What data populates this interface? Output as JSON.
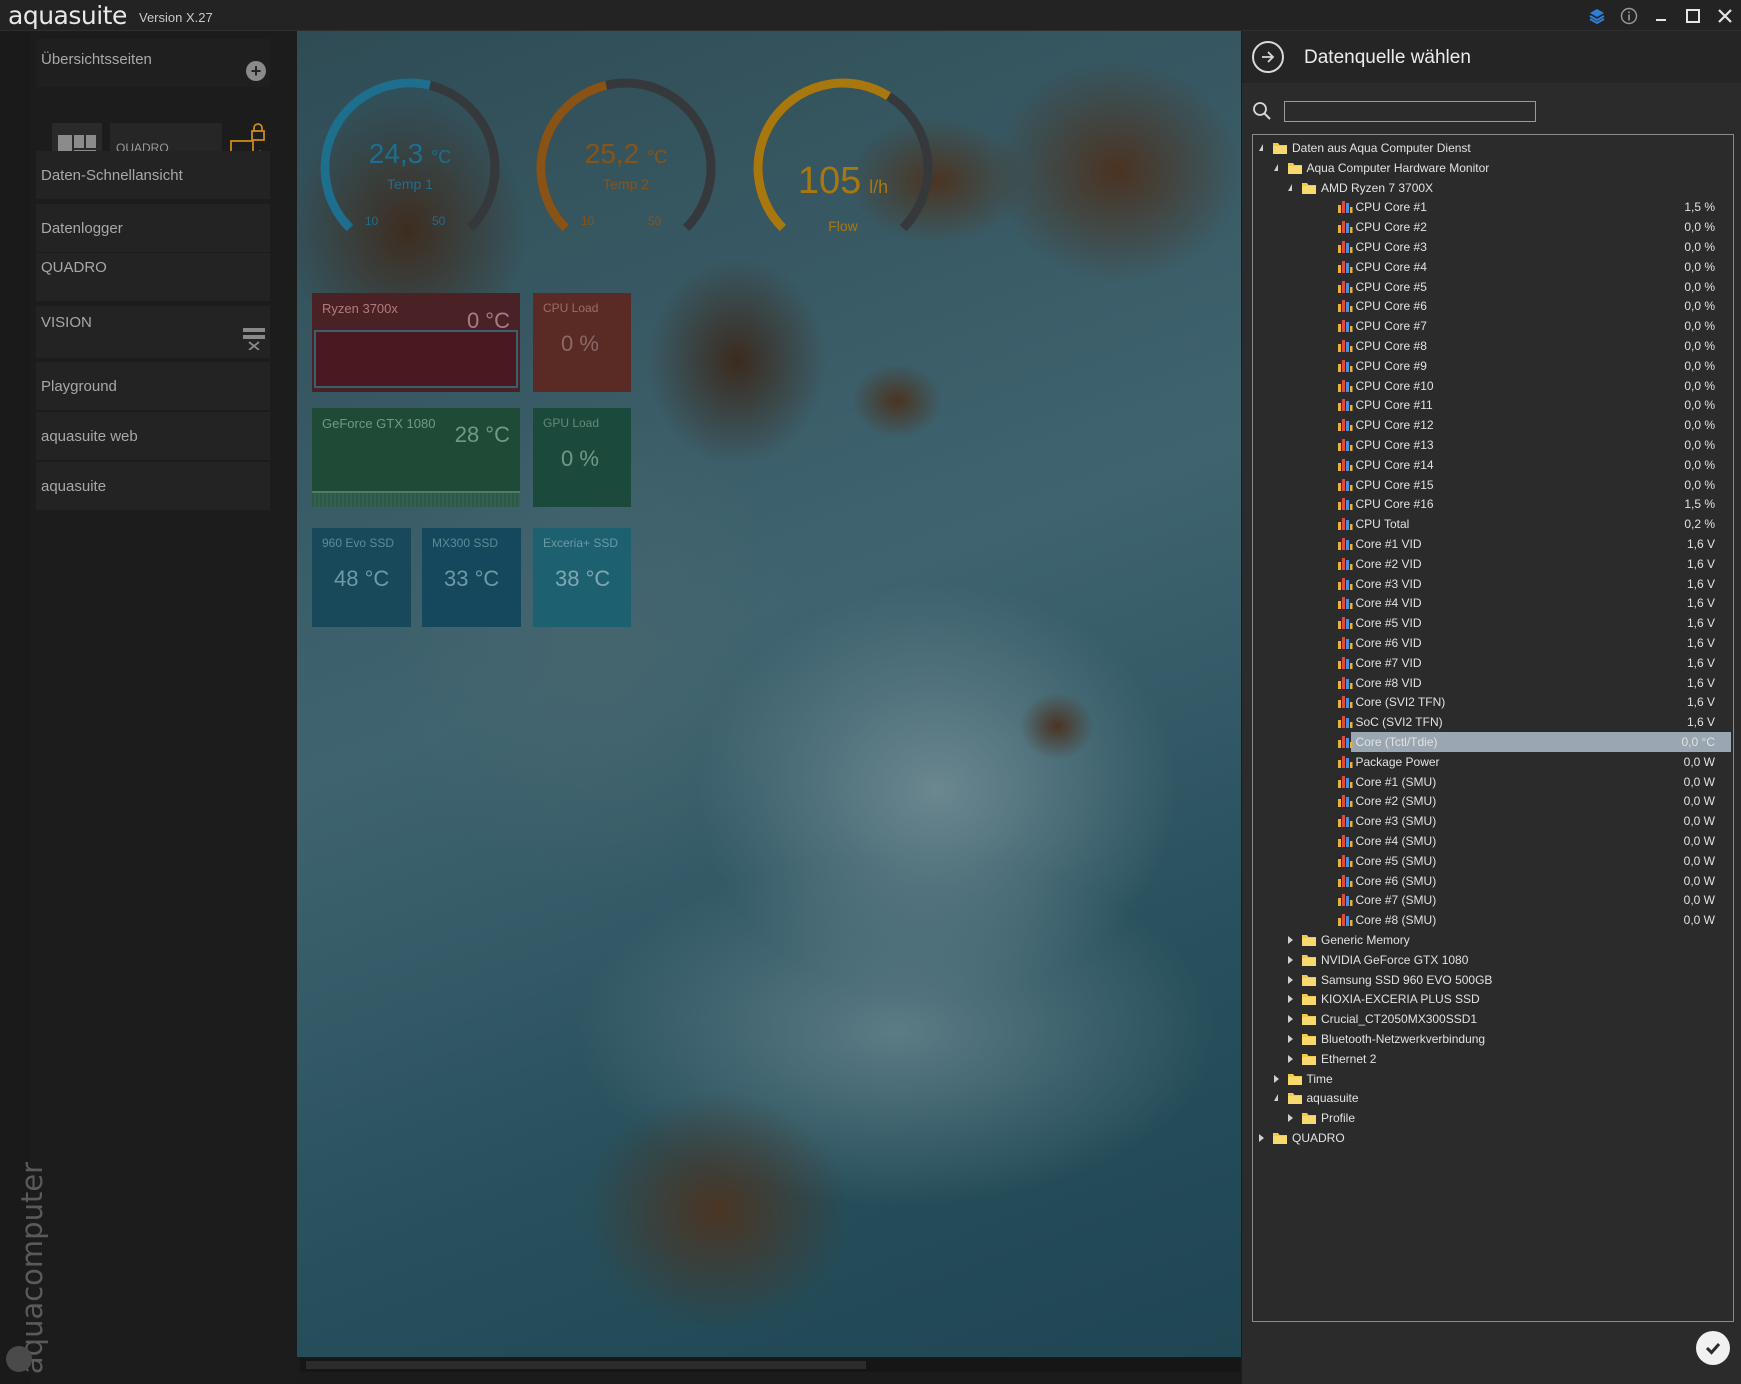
{
  "titlebar": {
    "app_name": "aquasuite",
    "version": "Version X.27",
    "icons": [
      "layers-icon",
      "info-icon",
      "minimize-icon",
      "maximize-icon",
      "close-icon"
    ]
  },
  "sidebar": {
    "overview_label": "Übersichtsseiten",
    "quadro_page_label": "QUADRO",
    "items": [
      {
        "label": "Daten-Schnellansicht"
      },
      {
        "label": "Datenlogger"
      },
      {
        "label": "QUADRO"
      },
      {
        "label": "VISION"
      },
      {
        "label": "Playground"
      },
      {
        "label": "aquasuite web"
      },
      {
        "label": "aquasuite"
      }
    ],
    "brand": "aquacomputer"
  },
  "dashboard": {
    "gauges": [
      {
        "value": "24,3",
        "unit": "°C",
        "name": "Temp 1",
        "min": "10",
        "max": "50",
        "color": "#1e6e8e",
        "fill": 0.55
      },
      {
        "value": "25,2",
        "unit": "°C",
        "name": "Temp 2",
        "min": "10",
        "max": "50",
        "color": "#8a5316",
        "fill": 0.45
      },
      {
        "value": "105",
        "unit": "l/h",
        "name": "Flow",
        "color": "#a8780e",
        "fill": 0.62
      }
    ],
    "tiles": [
      {
        "title": "Ryzen 3700x",
        "value": "0 °C"
      },
      {
        "title": "CPU Load",
        "value": "0 %"
      },
      {
        "title": "GeForce GTX 1080",
        "value": "28 °C"
      },
      {
        "title": "GPU Load",
        "value": "0 %"
      },
      {
        "title": "960 Evo SSD",
        "value": "48 °C"
      },
      {
        "title": "MX300 SSD",
        "value": "33 °C"
      },
      {
        "title": "Exceria+ SSD",
        "value": "38 °C"
      }
    ]
  },
  "panel": {
    "title": "Datenquelle wählen",
    "search_value": "",
    "tree": [
      {
        "level": 0,
        "label": "Daten aus Aqua Computer Dienst",
        "type": "folder",
        "expanded": true
      },
      {
        "level": 1,
        "label": "Aqua Computer Hardware Monitor",
        "type": "folder",
        "expanded": true
      },
      {
        "level": 2,
        "label": "AMD Ryzen 7 3700X",
        "type": "folder",
        "expanded": true
      },
      {
        "level": 3,
        "label": "CPU Core #1",
        "value": "1,5 %",
        "type": "sensor"
      },
      {
        "level": 3,
        "label": "CPU Core #2",
        "value": "0,0 %",
        "type": "sensor"
      },
      {
        "level": 3,
        "label": "CPU Core #3",
        "value": "0,0 %",
        "type": "sensor"
      },
      {
        "level": 3,
        "label": "CPU Core #4",
        "value": "0,0 %",
        "type": "sensor"
      },
      {
        "level": 3,
        "label": "CPU Core #5",
        "value": "0,0 %",
        "type": "sensor"
      },
      {
        "level": 3,
        "label": "CPU Core #6",
        "value": "0,0 %",
        "type": "sensor"
      },
      {
        "level": 3,
        "label": "CPU Core #7",
        "value": "0,0 %",
        "type": "sensor"
      },
      {
        "level": 3,
        "label": "CPU Core #8",
        "value": "0,0 %",
        "type": "sensor"
      },
      {
        "level": 3,
        "label": "CPU Core #9",
        "value": "0,0 %",
        "type": "sensor"
      },
      {
        "level": 3,
        "label": "CPU Core #10",
        "value": "0,0 %",
        "type": "sensor"
      },
      {
        "level": 3,
        "label": "CPU Core #11",
        "value": "0,0 %",
        "type": "sensor"
      },
      {
        "level": 3,
        "label": "CPU Core #12",
        "value": "0,0 %",
        "type": "sensor"
      },
      {
        "level": 3,
        "label": "CPU Core #13",
        "value": "0,0 %",
        "type": "sensor"
      },
      {
        "level": 3,
        "label": "CPU Core #14",
        "value": "0,0 %",
        "type": "sensor"
      },
      {
        "level": 3,
        "label": "CPU Core #15",
        "value": "0,0 %",
        "type": "sensor"
      },
      {
        "level": 3,
        "label": "CPU Core #16",
        "value": "1,5 %",
        "type": "sensor"
      },
      {
        "level": 3,
        "label": "CPU Total",
        "value": "0,2 %",
        "type": "sensor"
      },
      {
        "level": 3,
        "label": "Core #1 VID",
        "value": "1,6 V",
        "type": "sensor"
      },
      {
        "level": 3,
        "label": "Core #2 VID",
        "value": "1,6 V",
        "type": "sensor"
      },
      {
        "level": 3,
        "label": "Core #3 VID",
        "value": "1,6 V",
        "type": "sensor"
      },
      {
        "level": 3,
        "label": "Core #4 VID",
        "value": "1,6 V",
        "type": "sensor"
      },
      {
        "level": 3,
        "label": "Core #5 VID",
        "value": "1,6 V",
        "type": "sensor"
      },
      {
        "level": 3,
        "label": "Core #6 VID",
        "value": "1,6 V",
        "type": "sensor"
      },
      {
        "level": 3,
        "label": "Core #7 VID",
        "value": "1,6 V",
        "type": "sensor"
      },
      {
        "level": 3,
        "label": "Core #8 VID",
        "value": "1,6 V",
        "type": "sensor"
      },
      {
        "level": 3,
        "label": "Core (SVI2 TFN)",
        "value": "1,6 V",
        "type": "sensor"
      },
      {
        "level": 3,
        "label": "SoC (SVI2 TFN)",
        "value": "1,6 V",
        "type": "sensor"
      },
      {
        "level": 3,
        "label": "Core (Tctl/Tdie)",
        "value": "0,0 °C",
        "type": "sensor",
        "selected": true
      },
      {
        "level": 3,
        "label": "Package Power",
        "value": "0,0 W",
        "type": "sensor"
      },
      {
        "level": 3,
        "label": "Core #1 (SMU)",
        "value": "0,0 W",
        "type": "sensor"
      },
      {
        "level": 3,
        "label": "Core #2 (SMU)",
        "value": "0,0 W",
        "type": "sensor"
      },
      {
        "level": 3,
        "label": "Core #3 (SMU)",
        "value": "0,0 W",
        "type": "sensor"
      },
      {
        "level": 3,
        "label": "Core #4 (SMU)",
        "value": "0,0 W",
        "type": "sensor"
      },
      {
        "level": 3,
        "label": "Core #5 (SMU)",
        "value": "0,0 W",
        "type": "sensor"
      },
      {
        "level": 3,
        "label": "Core #6 (SMU)",
        "value": "0,0 W",
        "type": "sensor"
      },
      {
        "level": 3,
        "label": "Core #7 (SMU)",
        "value": "0,0 W",
        "type": "sensor"
      },
      {
        "level": 3,
        "label": "Core #8 (SMU)",
        "value": "0,0 W",
        "type": "sensor"
      },
      {
        "level": 2,
        "label": "Generic Memory",
        "type": "folder",
        "expanded": false
      },
      {
        "level": 2,
        "label": "NVIDIA GeForce GTX 1080",
        "type": "folder",
        "expanded": false
      },
      {
        "level": 2,
        "label": "Samsung SSD 960 EVO 500GB",
        "type": "folder",
        "expanded": false
      },
      {
        "level": 2,
        "label": "KIOXIA-EXCERIA PLUS SSD",
        "type": "folder",
        "expanded": false
      },
      {
        "level": 2,
        "label": "Crucial_CT2050MX300SSD1",
        "type": "folder",
        "expanded": false
      },
      {
        "level": 2,
        "label": "Bluetooth-Netzwerkverbindung",
        "type": "folder",
        "expanded": false
      },
      {
        "level": 2,
        "label": "Ethernet 2",
        "type": "folder",
        "expanded": false
      },
      {
        "level": 1,
        "label": "Time",
        "type": "folder",
        "expanded": false
      },
      {
        "level": 1,
        "label": "aquasuite",
        "type": "folder",
        "expanded": true
      },
      {
        "level": 2,
        "label": "Profile",
        "type": "folder",
        "expanded": false
      },
      {
        "level": 0,
        "label": "QUADRO",
        "type": "folder",
        "expanded": false
      }
    ]
  }
}
